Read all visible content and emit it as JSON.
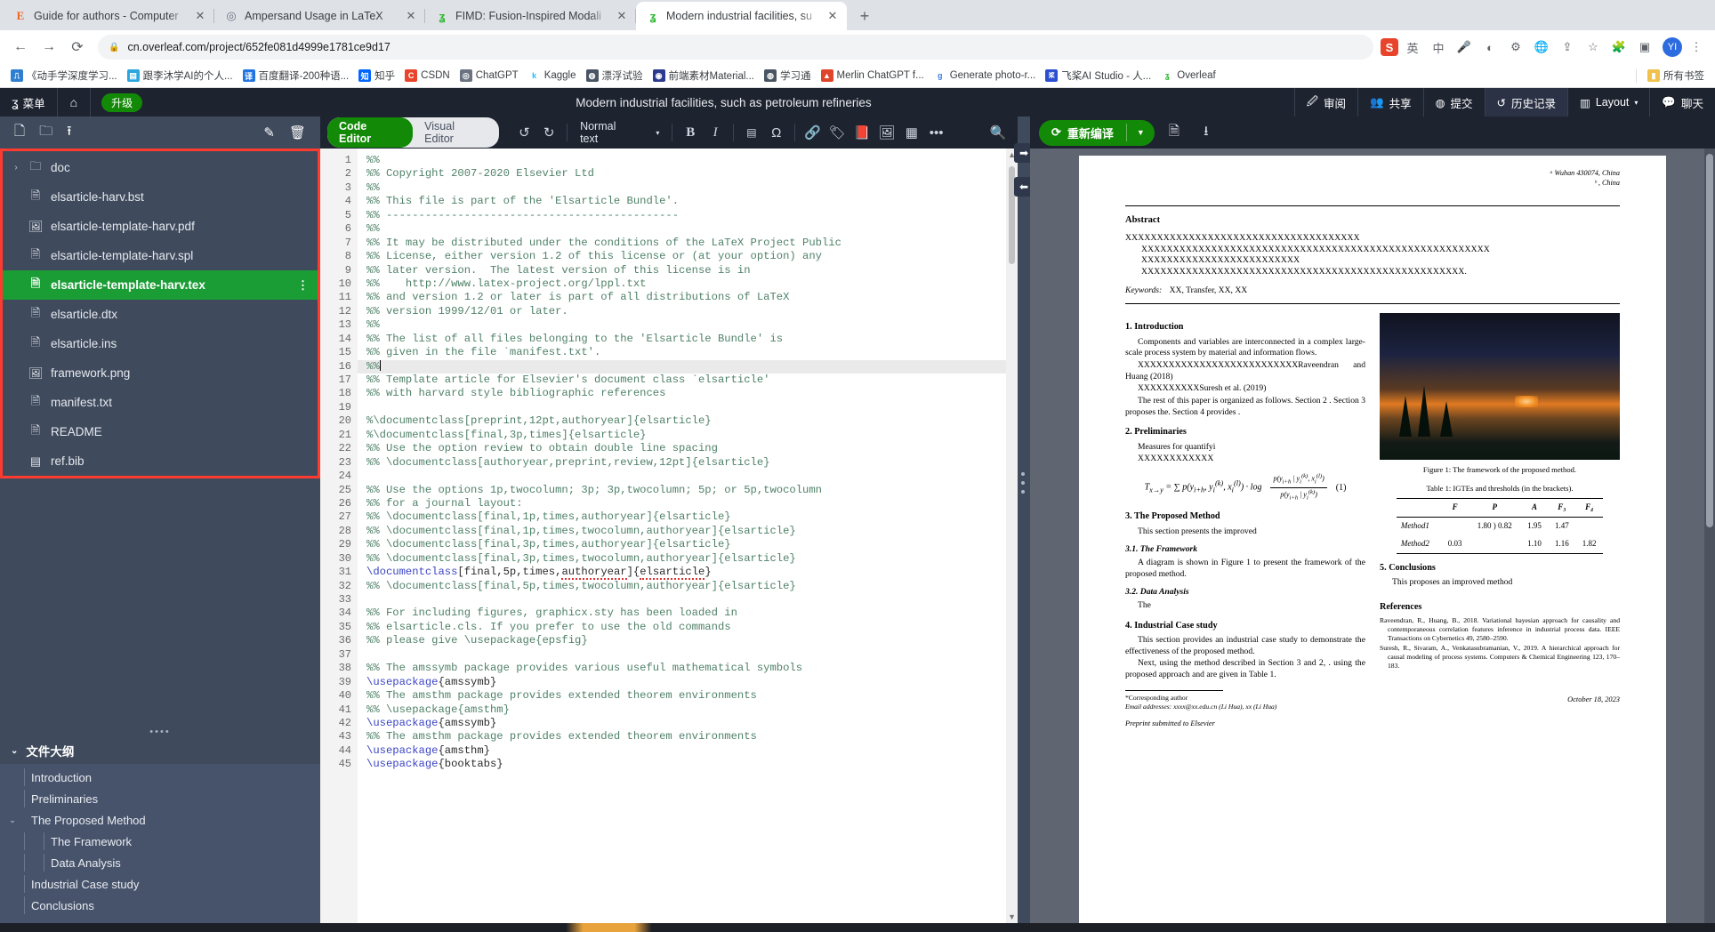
{
  "browser": {
    "tabs": [
      {
        "favicon": "E",
        "favicon_color": "#f26522",
        "title": "Guide for authors - Computer",
        "active": false
      },
      {
        "favicon": "◎",
        "favicon_color": "#6b7280",
        "title": "Ampersand Usage in LaTeX",
        "active": false
      },
      {
        "favicon": "ʓ",
        "favicon_color": "#2eb82e",
        "title": "FIMD: Fusion-Inspired Modali",
        "active": false
      },
      {
        "favicon": "ʓ",
        "favicon_color": "#2eb82e",
        "title": "Modern industrial facilities, su",
        "active": true
      }
    ],
    "newtab_label": "+",
    "nav": {
      "back": "←",
      "forward": "→",
      "reload": "⟳"
    },
    "url": "cn.overleaf.com/project/652fe081d4999e1781ce9d17",
    "lock_icon": "🔒",
    "omni_icons": [
      "translate-icon",
      "share-icon",
      "bookmark-star-icon",
      "extensions-icon",
      "window-icon"
    ],
    "profile_initials": "YI",
    "sogou_icon": "S",
    "omni_right_labels": [
      "英",
      "中",
      "mic",
      "color",
      "gear"
    ],
    "bookmarks": [
      {
        "label": "《动手学深度学习...",
        "color": "#2f7fd0",
        "glyph": "⎍"
      },
      {
        "label": "跟李沐学AI的个人...",
        "color": "#2aa7e0",
        "glyph": "▤"
      },
      {
        "label": "百度翻译-200种语...",
        "color": "#2274e0",
        "glyph": "译"
      },
      {
        "label": "知乎",
        "color": "#0066ff",
        "glyph": "知"
      },
      {
        "label": "CSDN",
        "color": "#e8442b",
        "glyph": "C"
      },
      {
        "label": "ChatGPT",
        "color": "#6b7280",
        "glyph": "◎"
      },
      {
        "label": "Kaggle",
        "color": "#20beff",
        "glyph": "k"
      },
      {
        "label": "漂浮试验",
        "color": "#4a5563",
        "glyph": "◍"
      },
      {
        "label": "前端素材Material...",
        "color": "#2b3a8f",
        "glyph": "◉"
      },
      {
        "label": "学习通",
        "color": "#4a5563",
        "glyph": "◍"
      },
      {
        "label": "Merlin ChatGPT f...",
        "color": "#e0452b",
        "glyph": "▲"
      },
      {
        "label": "Generate photo-r...",
        "color": "#3b7de0",
        "glyph": "g"
      },
      {
        "label": "飞桨AI Studio - 人...",
        "color": "#2b4fd0",
        "glyph": "桨"
      },
      {
        "label": "Overleaf",
        "color": "#2eb82e",
        "glyph": "ʓ"
      }
    ],
    "bookmarks_all": {
      "label": "所有书签",
      "glyph": "📙"
    }
  },
  "overleaf": {
    "menu_label": "菜单",
    "home_icon": "home-icon",
    "upgrade_label": "升级",
    "project_title": "Modern industrial facilities, such as petroleum refineries",
    "top_buttons": [
      {
        "label": "审阅",
        "icon": "review-icon",
        "highlight": false
      },
      {
        "label": "共享",
        "icon": "share-people-icon",
        "highlight": false
      },
      {
        "label": "提交",
        "icon": "submit-globe-icon",
        "highlight": false
      },
      {
        "label": "历史记录",
        "icon": "history-clock-icon",
        "highlight": true
      },
      {
        "label": "Layout",
        "icon": "layout-columns-icon",
        "highlight": false
      },
      {
        "label": "聊天",
        "icon": "chat-bubble-icon",
        "highlight": false
      }
    ],
    "sidebar": {
      "toolbar_icons": [
        "new-file-icon",
        "new-folder-icon",
        "upload-icon",
        "rename-pencil-icon",
        "delete-trash-icon"
      ],
      "files": [
        {
          "name": "doc",
          "type": "folder",
          "selected": false,
          "expandable": true
        },
        {
          "name": "elsarticle-harv.bst",
          "type": "file",
          "selected": false
        },
        {
          "name": "elsarticle-template-harv.pdf",
          "type": "image",
          "selected": false
        },
        {
          "name": "elsarticle-template-harv.spl",
          "type": "file",
          "selected": false
        },
        {
          "name": "elsarticle-template-harv.tex",
          "type": "file",
          "selected": true
        },
        {
          "name": "elsarticle.dtx",
          "type": "file",
          "selected": false
        },
        {
          "name": "elsarticle.ins",
          "type": "file",
          "selected": false
        },
        {
          "name": "framework.png",
          "type": "image",
          "selected": false
        },
        {
          "name": "manifest.txt",
          "type": "file",
          "selected": false
        },
        {
          "name": "README",
          "type": "file",
          "selected": false
        },
        {
          "name": "ref.bib",
          "type": "bib",
          "selected": false
        }
      ],
      "outline_title": "文件大纲",
      "outline": [
        {
          "label": "Introduction",
          "level": 1,
          "expandable": false
        },
        {
          "label": "Preliminaries",
          "level": 1,
          "expandable": false
        },
        {
          "label": "The Proposed Method",
          "level": 1,
          "expandable": true
        },
        {
          "label": "The Framework",
          "level": 2,
          "expandable": false
        },
        {
          "label": "Data Analysis",
          "level": 2,
          "expandable": false
        },
        {
          "label": "Industrial Case study",
          "level": 1,
          "expandable": false
        },
        {
          "label": "Conclusions",
          "level": 1,
          "expandable": false
        }
      ]
    },
    "editor_toolbar": {
      "code_editor_label": "Code Editor",
      "visual_editor_label": "Visual Editor",
      "undo_icon": "undo-icon",
      "redo_icon": "redo-icon",
      "style_select_value": "Normal text",
      "icons": [
        "bold-icon",
        "italic-icon",
        "list-icon",
        "omega-symbol-icon",
        "link-icon",
        "tag-icon",
        "cite-book-icon",
        "image-icon",
        "table-icon",
        "more-horizontal-icon",
        "search-icon"
      ]
    },
    "code": {
      "start_line": 1,
      "cursor_line": 16,
      "lines": [
        "%%",
        "%% Copyright 2007-2020 Elsevier Ltd",
        "%%",
        "%% This file is part of the 'Elsarticle Bundle'.",
        "%% ---------------------------------------------",
        "%%",
        "%% It may be distributed under the conditions of the LaTeX Project Public",
        "%% License, either version 1.2 of this license or (at your option) any",
        "%% later version.  The latest version of this license is in",
        "%%    http://www.latex-project.org/lppl.txt",
        "%% and version 1.2 or later is part of all distributions of LaTeX",
        "%% version 1999/12/01 or later.",
        "%%",
        "%% The list of all files belonging to the 'Elsarticle Bundle' is",
        "%% given in the file `manifest.txt'.",
        "%%",
        "%% Template article for Elsevier's document class `elsarticle'",
        "%% with harvard style bibliographic references",
        "",
        "%\\documentclass[preprint,12pt,authoryear]{elsarticle}",
        "%\\documentclass[final,3p,times]{elsarticle}",
        "%% Use the option review to obtain double line spacing",
        "%% \\documentclass[authoryear,preprint,review,12pt]{elsarticle}",
        "",
        "%% Use the options 1p,twocolumn; 3p; 3p,twocolumn; 5p; or 5p,twocolumn",
        "%% for a journal layout:",
        "%% \\documentclass[final,1p,times,authoryear]{elsarticle}",
        "%% \\documentclass[final,1p,times,twocolumn,authoryear]{elsarticle}",
        "%% \\documentclass[final,3p,times,authoryear]{elsarticle}",
        "%% \\documentclass[final,3p,times,twocolumn,authoryear]{elsarticle}",
        "\\documentclass[final,5p,times,authoryear]{elsarticle}",
        "%% \\documentclass[final,5p,times,twocolumn,authoryear]{elsarticle}",
        "",
        "%% For including figures, graphicx.sty has been loaded in",
        "%% elsarticle.cls. If you prefer to use the old commands",
        "%% please give \\usepackage{epsfig}",
        "",
        "%% The amssymb package provides various useful mathematical symbols",
        "\\usepackage{amssymb}",
        "%% The amsthm package provides extended theorem environments",
        "%% \\usepackage{amsthm}",
        "\\usepackage{amssymb}",
        "%% The amsthm package provides extended theorem environments",
        "\\usepackage{amsthm}",
        "\\usepackage{booktabs}"
      ]
    },
    "pdf": {
      "recompile_label": "重新编译",
      "recompile_icon": "refresh-icon",
      "dropdown_icon": "chevron-down-icon",
      "logs_icon": "file-logs-icon",
      "download_icon": "download-icon",
      "document": {
        "affiliation_a": "ᵃ Wuhan 430074, China",
        "affiliation_b": "ᵇ , China",
        "abstract_heading": "Abstract",
        "abstract_lines": [
          "XXXXXXXXXXXXXXXXXXXXXXXXXXXXXXXXXXXXX",
          "XXXXXXXXXXXXXXXXXXXXXXXXXXXXXXXXXXXXXXXXXXXXXXXXXXXXXXX",
          "XXXXXXXXXXXXXXXXXXXXXXXXX",
          "XXXXXXXXXXXXXXXXXXXXXXXXXXXXXXXXXXXXXXXXXXXXXXXXXXX."
        ],
        "keywords_label": "Keywords:",
        "keywords_value": "XX, Transfer, XX, XX",
        "sec1_title": "1.  Introduction",
        "sec1_p1": "Components and variables are interconnected in a complex large-scale process system by material and information flows.",
        "sec1_p2": "XXXXXXXXXXXXXXXXXXXXXXXXXXRaveendran and Huang (2018)",
        "sec1_p3": "XXXXXXXXXXSuresh et al. (2019)",
        "sec1_p4": "The rest of this paper is organized as follows.  Section 2 . Section 3 proposes the. Section 4 provides .",
        "sec2_title": "2.  Preliminaries",
        "sec2_p1": "Measures for quantifyi",
        "sec2_p2": "XXXXXXXXXXXX",
        "equation_number": "(1)",
        "sec3_title": "3.  The Proposed Method",
        "sec3_p1": "This section presents the improved",
        "sec31_title": "3.1.  The Framework",
        "sec31_p1": "A diagram is shown in Figure 1 to present the framework of the proposed method.",
        "sec32_title": "3.2.  Data Analysis",
        "sec32_p1": "The",
        "sec4_title": "4.  Industrial Case study",
        "sec4_p1": "This section provides an industrial case study to demonstrate the effectiveness of the proposed method.",
        "sec4_p2": "Next, using the method described in Section 3 and 2, . using the proposed approach and are given in Table 1.",
        "figure_caption": "Figure 1: The framework of the proposed method.",
        "table_caption": "Table 1: IGTEs and thresholds (in the brackets).",
        "table_headers": [
          "",
          "F",
          "P",
          "A",
          "F₃",
          "F₄"
        ],
        "table_rows": [
          [
            "Method1",
            "",
            "1.80 ) 0.82",
            "1.95",
            "1.47",
            ""
          ],
          [
            "Method2",
            "0.03",
            "",
            "1.10",
            "1.16",
            "1.82"
          ]
        ],
        "sec5_title": "5.  Conclusions",
        "sec5_p1": "This proposes an improved method",
        "references_title": "References",
        "references": [
          "Raveendran, R., Huang, B., 2018.  Variational bayesian approach for causality and contemporaneous correlation features inference in industrial process data. IEEE Transactions on Cybernetics 49, 2580–2590.",
          "Suresh, R., Sivaram, A., Venkatasubramanian, V., 2019.  A hierarchical approach for causal modeling of process systems.  Computers & Chemical Engineering 123, 170–183."
        ],
        "footnote_star": "*Corresponding author",
        "footnote_email": "Email addresses: xxxx@xx.edu.cn (Li Hua), xx (Li Hua)",
        "preprint_left": "Preprint submitted to Elsevier",
        "preprint_right": "October 18, 2023"
      }
    }
  }
}
